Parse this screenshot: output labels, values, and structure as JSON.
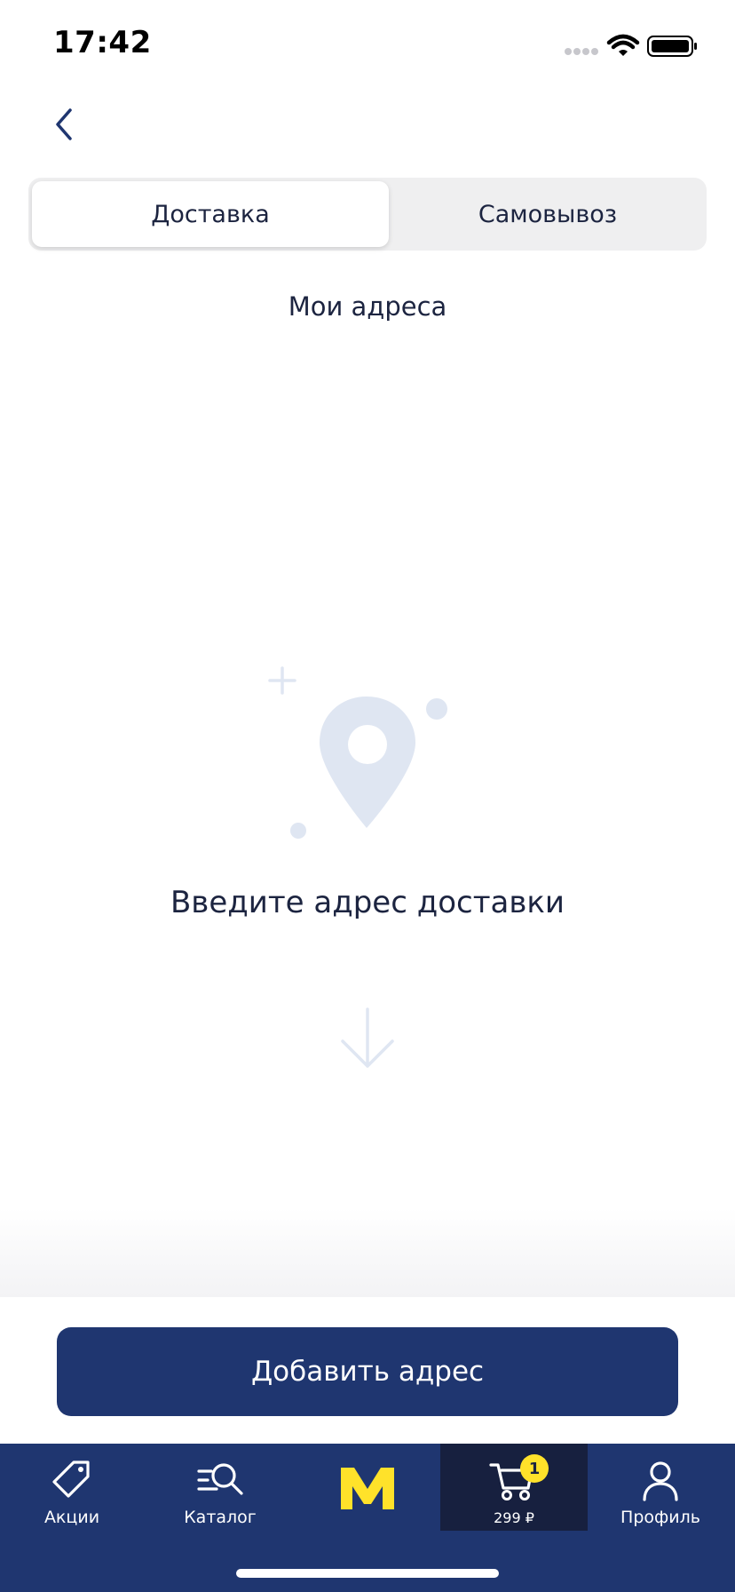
{
  "status_bar": {
    "time": "17:42"
  },
  "navigation": {
    "back_icon": "chevron-left-icon"
  },
  "segmented_control": {
    "options": [
      {
        "label": "Доставка",
        "selected": true
      },
      {
        "label": "Самовывоз",
        "selected": false
      }
    ]
  },
  "section": {
    "title": "Мои адреса"
  },
  "empty_state": {
    "icon": "map-pin-icon",
    "message": "Введите адрес доставки",
    "arrow_icon": "arrow-down-icon"
  },
  "primary_action": {
    "label": "Добавить адрес"
  },
  "tab_bar": {
    "items": [
      {
        "label": "Акции",
        "icon": "tag-icon"
      },
      {
        "label": "Каталог",
        "icon": "catalog-search-icon"
      },
      {
        "label": "",
        "icon": "m-logo-icon"
      },
      {
        "label": "299 ₽",
        "icon": "cart-icon",
        "badge": "1"
      },
      {
        "label": "Профиль",
        "icon": "user-icon"
      }
    ]
  },
  "colors": {
    "brand_dark_blue": "#1f3670",
    "cart_tab_bg": "#17203f",
    "accent_yellow": "#ffe22a",
    "illustration_light_blue": "#dfe6f2",
    "text_dark": "#1c2440"
  }
}
